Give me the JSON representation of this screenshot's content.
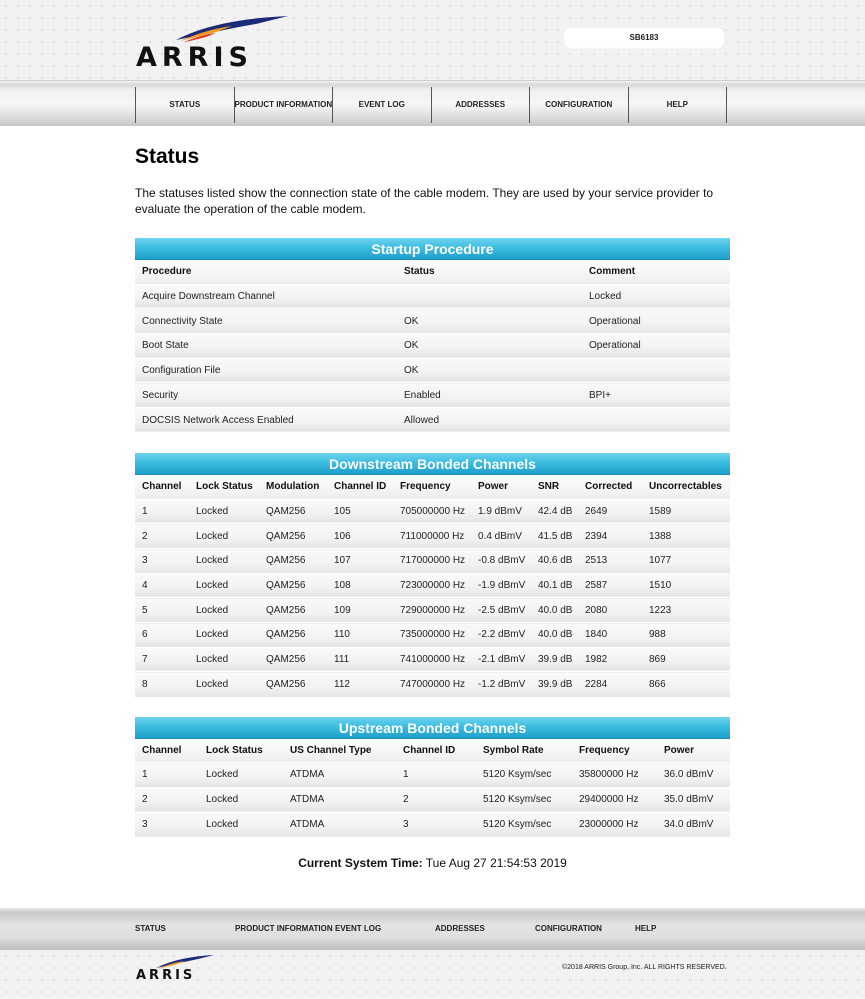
{
  "header": {
    "logo_text": "ARRIS",
    "model": "SB6183"
  },
  "nav": [
    "STATUS",
    "PRODUCT INFORMATION",
    "EVENT LOG",
    "ADDRESSES",
    "CONFIGURATION",
    "HELP"
  ],
  "page": {
    "title": "Status",
    "intro": "The statuses listed show the connection state of the cable modem. They are used by your service provider to evaluate the operation of the cable modem."
  },
  "startup": {
    "title": "Startup Procedure",
    "headers": [
      "Procedure",
      "Status",
      "Comment"
    ],
    "rows": [
      [
        "Acquire Downstream Channel",
        "",
        "Locked"
      ],
      [
        "Connectivity State",
        "OK",
        "Operational"
      ],
      [
        "Boot State",
        "OK",
        "Operational"
      ],
      [
        "Configuration File",
        "OK",
        ""
      ],
      [
        "Security",
        "Enabled",
        "BPI+"
      ],
      [
        "DOCSIS Network Access Enabled",
        "Allowed",
        ""
      ]
    ]
  },
  "downstream": {
    "title": "Downstream Bonded Channels",
    "headers": [
      "Channel",
      "Lock Status",
      "Modulation",
      "Channel ID",
      "Frequency",
      "Power",
      "SNR",
      "Corrected",
      "Uncorrectables"
    ],
    "rows": [
      [
        "1",
        "Locked",
        "QAM256",
        "105",
        "705000000 Hz",
        "1.9 dBmV",
        "42.4 dB",
        "2649",
        "1589"
      ],
      [
        "2",
        "Locked",
        "QAM256",
        "106",
        "711000000 Hz",
        "0.4 dBmV",
        "41.5 dB",
        "2394",
        "1388"
      ],
      [
        "3",
        "Locked",
        "QAM256",
        "107",
        "717000000 Hz",
        "-0.8 dBmV",
        "40.6 dB",
        "2513",
        "1077"
      ],
      [
        "4",
        "Locked",
        "QAM256",
        "108",
        "723000000 Hz",
        "-1.9 dBmV",
        "40.1 dB",
        "2587",
        "1510"
      ],
      [
        "5",
        "Locked",
        "QAM256",
        "109",
        "729000000 Hz",
        "-2.5 dBmV",
        "40.0 dB",
        "2080",
        "1223"
      ],
      [
        "6",
        "Locked",
        "QAM256",
        "110",
        "735000000 Hz",
        "-2.2 dBmV",
        "40.0 dB",
        "1840",
        "988"
      ],
      [
        "7",
        "Locked",
        "QAM256",
        "111",
        "741000000 Hz",
        "-2.1 dBmV",
        "39.9 dB",
        "1982",
        "869"
      ],
      [
        "8",
        "Locked",
        "QAM256",
        "112",
        "747000000 Hz",
        "-1.2 dBmV",
        "39.9 dB",
        "2284",
        "866"
      ]
    ]
  },
  "upstream": {
    "title": "Upstream Bonded Channels",
    "headers": [
      "Channel",
      "Lock Status",
      "US Channel Type",
      "Channel ID",
      "Symbol Rate",
      "Frequency",
      "Power"
    ],
    "rows": [
      [
        "1",
        "Locked",
        "ATDMA",
        "1",
        "5120 Ksym/sec",
        "35800000 Hz",
        "36.0 dBmV"
      ],
      [
        "2",
        "Locked",
        "ATDMA",
        "2",
        "5120 Ksym/sec",
        "29400000 Hz",
        "35.0 dBmV"
      ],
      [
        "3",
        "Locked",
        "ATDMA",
        "3",
        "5120 Ksym/sec",
        "23000000 Hz",
        "34.0 dBmV"
      ]
    ]
  },
  "system_time": {
    "label": "Current System Time:",
    "value": "Tue Aug 27 21:54:53 2019"
  },
  "footer": {
    "links": [
      "STATUS",
      "PRODUCT INFORMATION",
      "EVENT LOG",
      "ADDRESSES",
      "CONFIGURATION",
      "HELP"
    ],
    "logo_text": "ARRIS",
    "copyright": "©2018 ARRIS Group, Inc. ALL RIGHTS RESERVED."
  },
  "colors": {
    "table_header_blue": "#3dbde0",
    "logo_orange": "#f39a1e",
    "logo_navy": "#1c2a7a"
  }
}
